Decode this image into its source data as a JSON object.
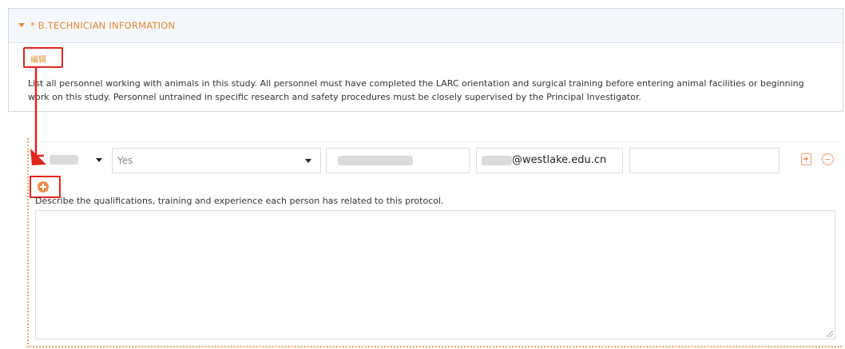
{
  "section": {
    "title": "* B.TECHNICIAN INFORMATION",
    "edit_label": "编辑",
    "instructions": "List all personnel working with animals in this study. All personnel must have completed the LARC orientation and surgical training before entering animal facilities or beginning work on this study. Personnel untrained in specific research and safety procedures must be closely supervised by the Principal Investigator."
  },
  "personnel_row": {
    "trained_select_value": "Yes",
    "email_value": "@westlake.edu.cn",
    "extra_value": ""
  },
  "qualifications": {
    "label": "Describe the qualifications, training and experience each person has related to this protocol.",
    "value": ""
  },
  "colors": {
    "accent": "#e0892e",
    "highlight_red": "#e1261c",
    "icon_orange": "#f09a6b"
  },
  "icons": [
    "caret-down-icon",
    "dropdown-arrow-icon",
    "copy-row-icon",
    "remove-row-icon",
    "add-row-icon",
    "red-arrow-annotation"
  ]
}
